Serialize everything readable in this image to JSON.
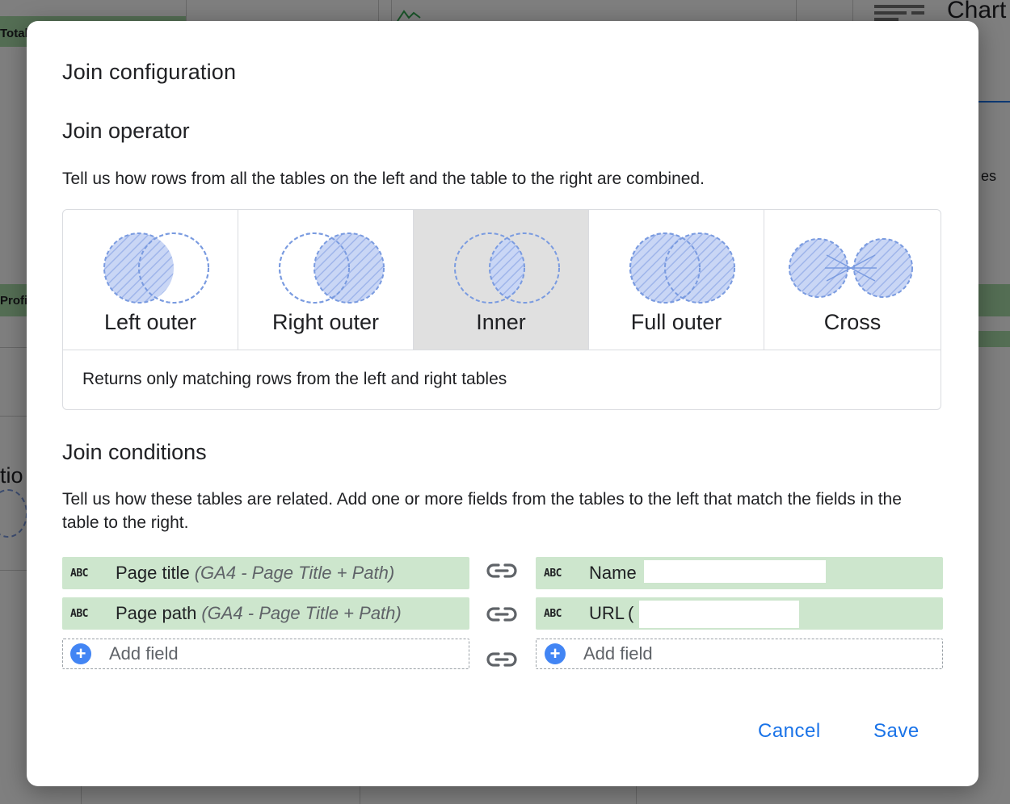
{
  "background": {
    "chart_label": "Chart",
    "left_text_1": "Total",
    "left_text_2": "Profi",
    "left_text_3": "tio",
    "right_text_1": "es"
  },
  "dialog": {
    "title": "Join configuration",
    "operator_section": {
      "title": "Join operator",
      "description": "Tell us how rows from all the tables on the left and the table to the right are combined.",
      "options": [
        {
          "label": "Left outer",
          "icon": "left-outer-join-icon"
        },
        {
          "label": "Right outer",
          "icon": "right-outer-join-icon"
        },
        {
          "label": "Inner",
          "icon": "inner-join-icon",
          "selected": true
        },
        {
          "label": "Full outer",
          "icon": "full-outer-join-icon"
        },
        {
          "label": "Cross",
          "icon": "cross-join-icon"
        }
      ],
      "selected_description": "Returns only matching rows from the left and right tables"
    },
    "conditions_section": {
      "title": "Join conditions",
      "description": "Tell us how these tables are related. Add one or more fields from the tables to the left that match the fields in the table to the right.",
      "rows": [
        {
          "left": {
            "type_label": "ABC",
            "name": "Page title",
            "source": "(GA4 - Page Title + Path)"
          },
          "right": {
            "type_label": "ABC",
            "name": "Name",
            "source": ""
          }
        },
        {
          "left": {
            "type_label": "ABC",
            "name": "Page path",
            "source": "(GA4 - Page Title + Path)"
          },
          "right": {
            "type_label": "ABC",
            "name": "URL",
            "source": "("
          }
        }
      ],
      "add_field_label": "Add field",
      "plus_glyph": "+"
    },
    "buttons": {
      "cancel": "Cancel",
      "save": "Save"
    }
  },
  "colors": {
    "accent": "#1a73e8",
    "chip_green": "#cde6cd",
    "venn_fill": "#c9d6f5",
    "venn_stroke": "#7a9be0",
    "selected_bg": "#e0e0e0"
  }
}
